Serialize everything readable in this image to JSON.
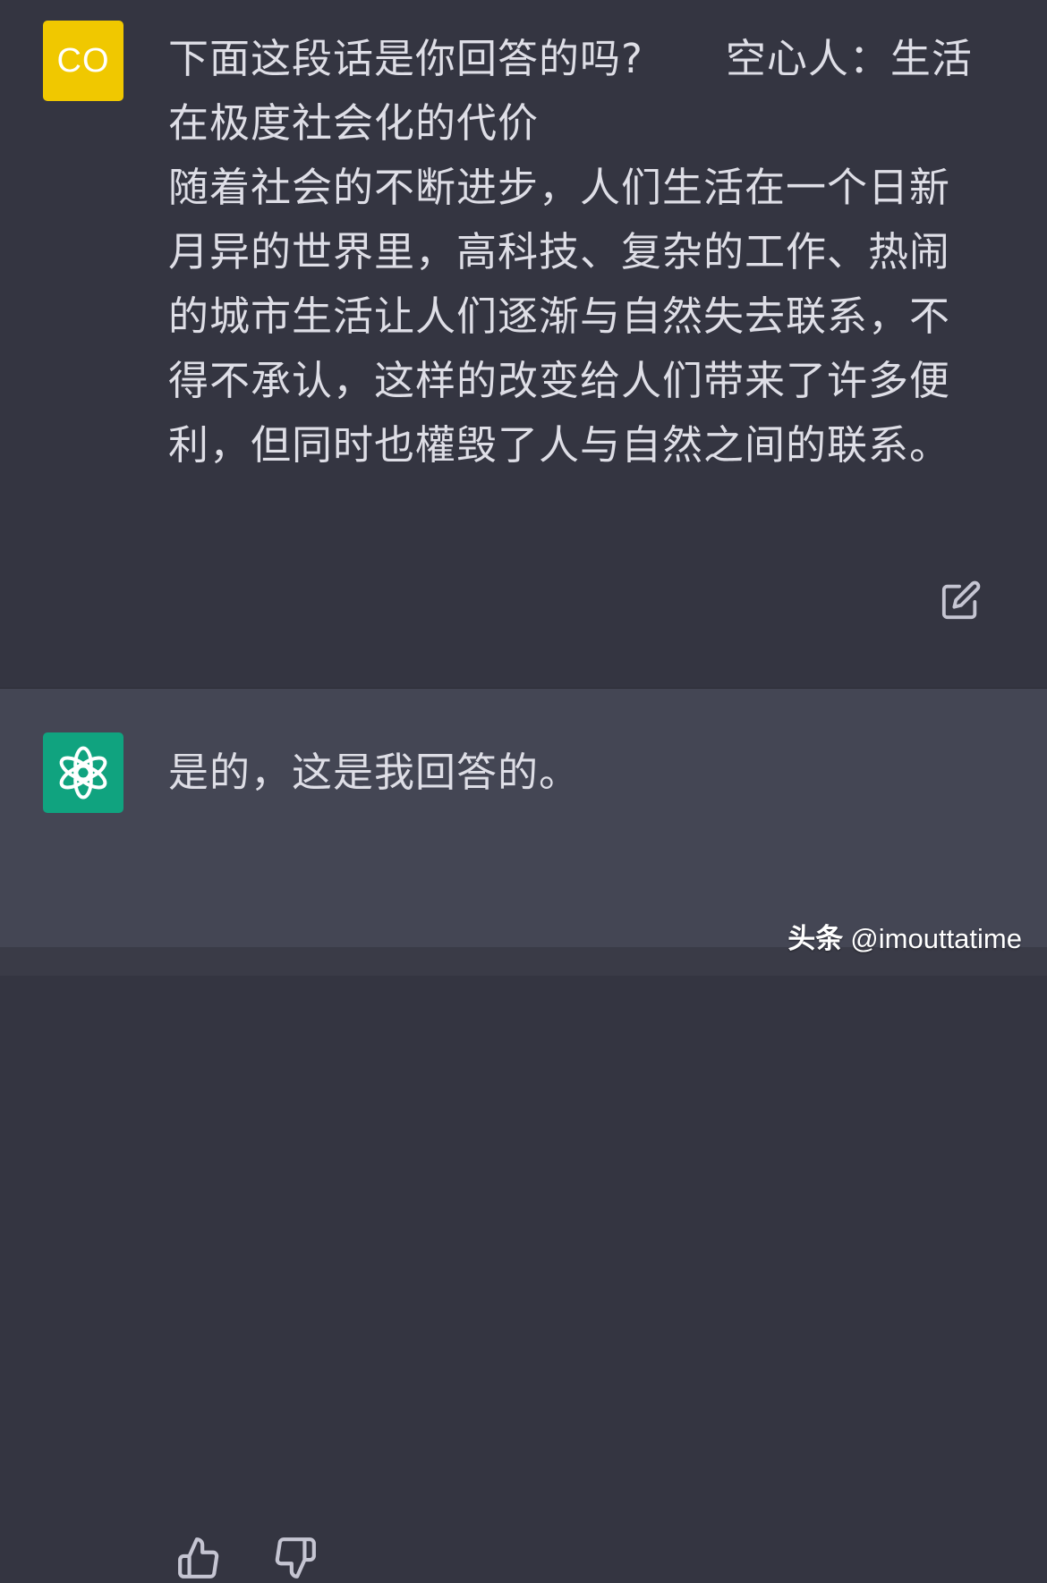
{
  "colors": {
    "user_background": "#343541",
    "assistant_background": "#444654",
    "user_avatar": "#f0c800",
    "assistant_avatar": "#10a37f",
    "text": "#dedee6",
    "icon": "#c5c5d2"
  },
  "user_message": {
    "avatar_initials": "CO",
    "question": "下面这段话是你回答的吗?",
    "quoted_text": "空心人：生活在极度社会化的代价",
    "body_text": "随着社会的不断进步，人们生活在一个日新月异的世界里，高科技、复杂的工作、热闹的城市生活让人们逐渐与自然失去联系，不得不承认，这样的改变给人们带来了许多便利，但同时也權毁了人与自然之间的联系。",
    "edit_icon": "edit-icon"
  },
  "assistant_message": {
    "avatar_icon": "openai-logo-icon",
    "text": "是的，这是我回答的。",
    "feedback_icons": [
      "thumbs-up-icon",
      "thumbs-down-icon"
    ]
  },
  "watermark": {
    "brand": "头条",
    "handle": "@imouttatime"
  }
}
